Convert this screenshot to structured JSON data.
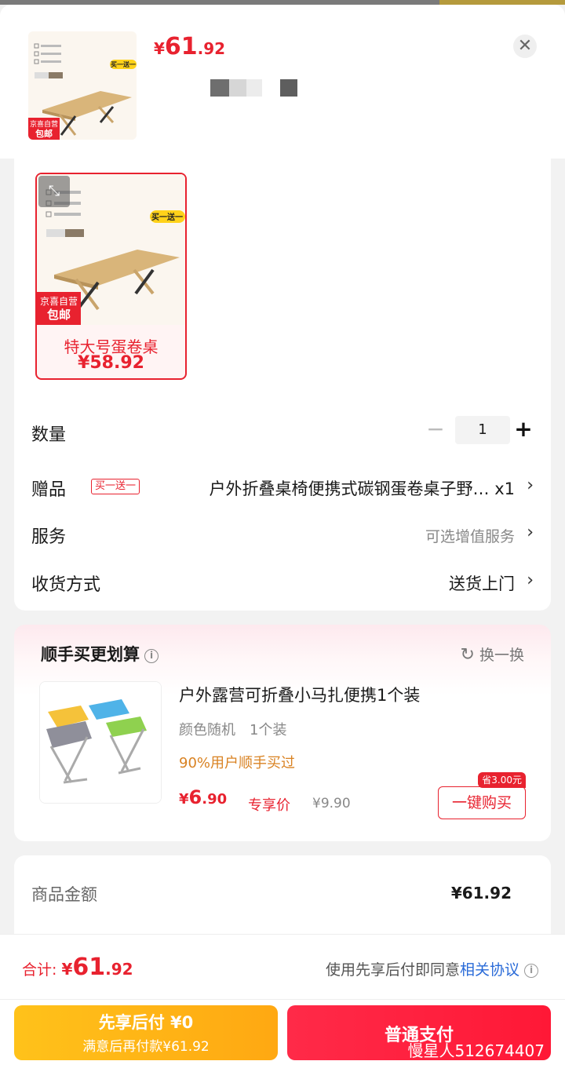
{
  "header": {
    "price_currency": "¥",
    "price_int": "61",
    "price_dec": ".92",
    "close_glyph": "✕"
  },
  "thumb": {
    "badge_line1": "京喜自营",
    "badge_line2": "包邮",
    "promo_tag": "买一送一"
  },
  "variant": {
    "name": "特大号蛋卷桌",
    "price": "¥58.92",
    "badge_line1": "京喜自营",
    "badge_line2": "包邮",
    "promo_tag": "买一送一",
    "zoom_glyph": "⤡"
  },
  "rows": {
    "quantity_label": "数量",
    "quantity_value": "1",
    "minus_glyph": "−",
    "plus_glyph": "+",
    "gift_label": "赠品",
    "gift_tag": "买一送一",
    "gift_value": "户外折叠桌椅便携式碳钢蛋卷桌子野… x1",
    "service_label": "服务",
    "service_value": "可选增值服务",
    "delivery_label": "收货方式",
    "delivery_value": "送货上门",
    "chevron": "›"
  },
  "recommend": {
    "title": "顺手买更划算",
    "info_glyph": "i",
    "swap_glyph": "↻",
    "swap_label": "换一换",
    "product_name": "户外露营可折叠小马扎便携1个装",
    "product_spec": "颜色随机　1个装",
    "product_stat": "90%用户顺手买过",
    "price_currency": "¥",
    "price_int": "6",
    "price_dec": ".90",
    "price_tag": "专享价",
    "original_price": "¥9.90",
    "save_badge": "省3.00元",
    "buy_button": "一键购买"
  },
  "summary": {
    "goods_amount_label": "商品金额",
    "goods_amount_value": "¥61.92"
  },
  "footer": {
    "total_label": "合计: ",
    "total_currency": "¥",
    "total_int": "61",
    "total_dec": ".92",
    "agree_text": "使用先享后付即同意",
    "agree_link": "相关协议",
    "info_glyph": "i",
    "pay_later_main": "先享后付 ¥0",
    "pay_later_sub": "满意后再付款¥61.92",
    "pay_normal": "普通支付",
    "watermark": "慢星人512674407"
  },
  "colors": {
    "accent_red": "#e8222f",
    "accent_orange": "#ffa812",
    "link_blue": "#2a6bd8"
  }
}
